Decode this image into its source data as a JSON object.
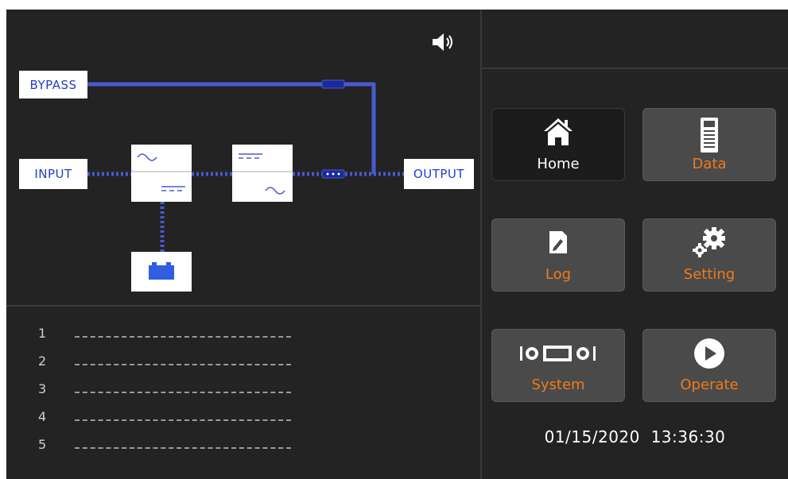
{
  "diagram": {
    "bypass_label": "BYPASS",
    "input_label": "INPUT",
    "output_label": "OUTPUT"
  },
  "messages": [
    {
      "num": "1",
      "text": ""
    },
    {
      "num": "2",
      "text": ""
    },
    {
      "num": "3",
      "text": ""
    },
    {
      "num": "4",
      "text": ""
    },
    {
      "num": "5",
      "text": ""
    }
  ],
  "menu": {
    "home": "Home",
    "data": "Data",
    "log": "Log",
    "setting": "Setting",
    "system": "System",
    "operate": "Operate"
  },
  "status": {
    "datetime": "01/15/2020  13:36:30"
  },
  "colors": {
    "accent": "#f07a1a",
    "flow_line": "#4a5ad0",
    "label_text": "#1f3ec9"
  },
  "icons": {
    "speaker": "speaker-icon",
    "home": "house-icon",
    "data": "data-meter-icon",
    "log": "log-edit-icon",
    "setting": "gears-icon",
    "system": "system-panel-icon",
    "operate": "play-icon"
  }
}
